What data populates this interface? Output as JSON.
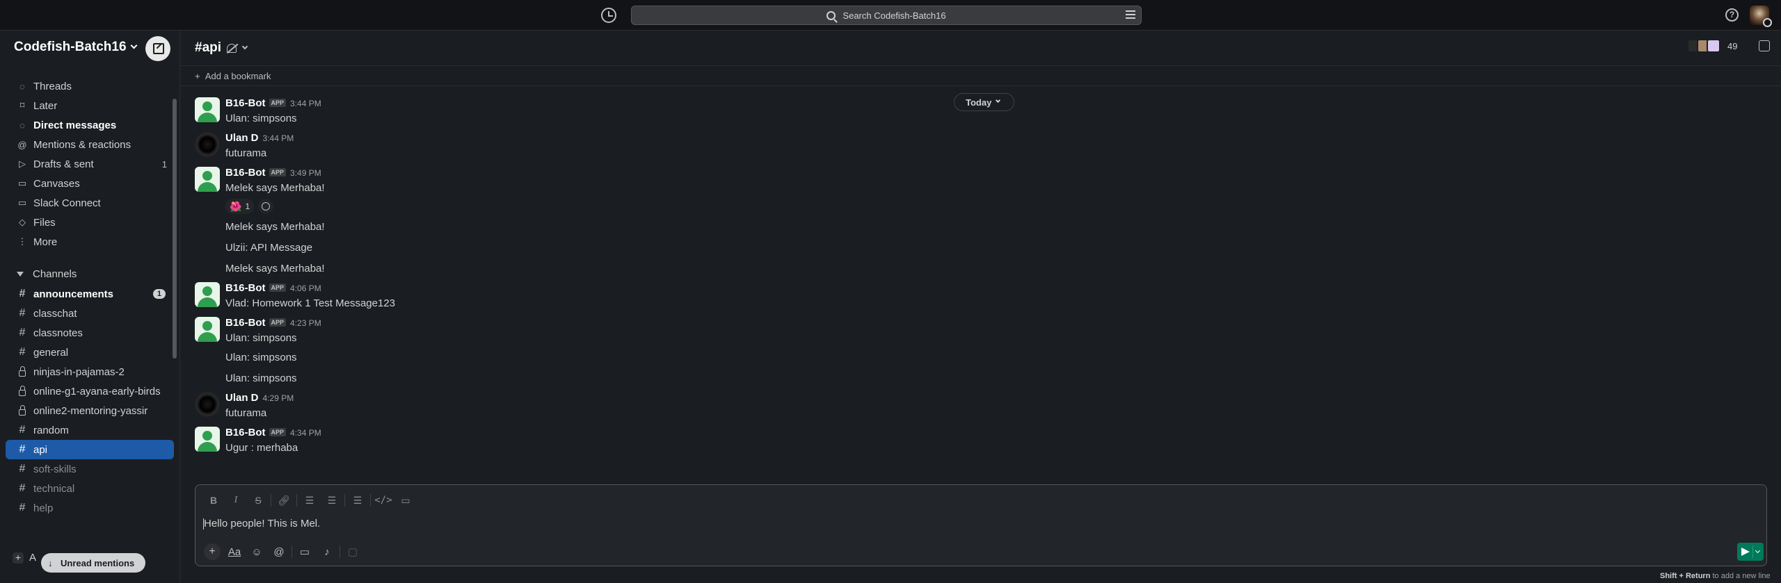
{
  "topbar": {
    "search_placeholder": "Search Codefish-Batch16"
  },
  "workspace": {
    "name": "Codefish-Batch16"
  },
  "nav": [
    {
      "label": "Threads",
      "icon": "threads-icon",
      "bold": false
    },
    {
      "label": "Later",
      "icon": "bookmark-icon",
      "bold": false
    },
    {
      "label": "Direct messages",
      "icon": "dm-icon",
      "bold": true
    },
    {
      "label": "Mentions & reactions",
      "icon": "at-icon",
      "bold": false
    },
    {
      "label": "Drafts & sent",
      "icon": "send-icon",
      "bold": false,
      "count": "1"
    },
    {
      "label": "Canvases",
      "icon": "canvas-icon",
      "bold": false
    },
    {
      "label": "Slack Connect",
      "icon": "building-icon",
      "bold": false
    },
    {
      "label": "Files",
      "icon": "files-icon",
      "bold": false
    },
    {
      "label": "More",
      "icon": "more-icon",
      "bold": false
    }
  ],
  "channels_section": "Channels",
  "channels": [
    {
      "name": "announcements",
      "type": "public",
      "bold": true,
      "badge": "1"
    },
    {
      "name": "classchat",
      "type": "public"
    },
    {
      "name": "classnotes",
      "type": "public"
    },
    {
      "name": "general",
      "type": "public"
    },
    {
      "name": "ninjas-in-pajamas-2",
      "type": "private"
    },
    {
      "name": "online-g1-ayana-early-birds",
      "type": "private"
    },
    {
      "name": "online2-mentoring-yassir",
      "type": "private"
    },
    {
      "name": "random",
      "type": "public"
    },
    {
      "name": "api",
      "type": "public",
      "active": true
    },
    {
      "name": "soft-skills",
      "type": "public",
      "dim": true
    },
    {
      "name": "technical",
      "type": "public",
      "dim": true
    },
    {
      "name": "help",
      "type": "public",
      "dim": true
    }
  ],
  "add_channel_label": "A",
  "unread_mentions": "Unread mentions",
  "footer_channel": "api",
  "header": {
    "channel": "api",
    "member_count": "49",
    "add_bookmark": "Add a bookmark"
  },
  "date_divider": "Today",
  "messages": [
    {
      "user": "B16-Bot",
      "app": "APP",
      "time": "3:44 PM",
      "lines": [
        "Ulan: simpsons"
      ],
      "avatar": "bot"
    },
    {
      "user": "Ulan D",
      "time": "3:44 PM",
      "lines": [
        "futurama"
      ],
      "avatar": "ulan"
    },
    {
      "user": "B16-Bot",
      "app": "APP",
      "time": "3:49 PM",
      "lines": [
        "Melek says Merhaba!"
      ],
      "avatar": "bot",
      "reaction": {
        "emoji": "🌺",
        "count": "1"
      },
      "continuations": [
        "Melek says Merhaba!",
        "Ulzii: API Message",
        "Melek says Merhaba!"
      ]
    },
    {
      "user": "B16-Bot",
      "app": "APP",
      "time": "4:06 PM",
      "lines": [
        "Vlad: Homework 1 Test Message123"
      ],
      "avatar": "bot"
    },
    {
      "user": "B16-Bot",
      "app": "APP",
      "time": "4:23 PM",
      "lines": [
        "Ulan: simpsons"
      ],
      "avatar": "bot",
      "continuations": [
        "Ulan: simpsons",
        "Ulan: simpsons"
      ]
    },
    {
      "user": "Ulan D",
      "time": "4:29 PM",
      "lines": [
        "futurama"
      ],
      "avatar": "ulan"
    },
    {
      "user": "B16-Bot",
      "app": "APP",
      "time": "4:34 PM",
      "lines": [
        "Ugur : merhaba"
      ],
      "avatar": "bot"
    }
  ],
  "composer": {
    "value": "Hello people! This is Mel.",
    "hint_key": "Shift + Return",
    "hint_text": " to add a new line"
  }
}
